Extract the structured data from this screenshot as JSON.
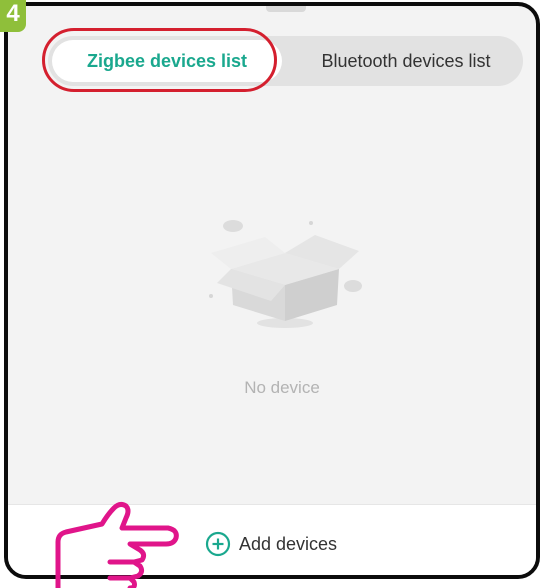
{
  "step": {
    "number": "4",
    "color": "#8fbf3a"
  },
  "tabs": [
    {
      "label": "Zigbee devices list",
      "selected": true
    },
    {
      "label": "Bluetooth devices list",
      "selected": false
    }
  ],
  "empty_state": {
    "label": "No device",
    "icon": "empty-box-icon"
  },
  "footer": {
    "add_label": "Add devices",
    "add_icon": "plus-circle-icon"
  },
  "colors": {
    "accent": "#1aa88e",
    "highlight": "#d41f2e",
    "pointer": "#e0158a"
  },
  "annotation": {
    "pointer_icon": "pointing-hand-icon"
  }
}
